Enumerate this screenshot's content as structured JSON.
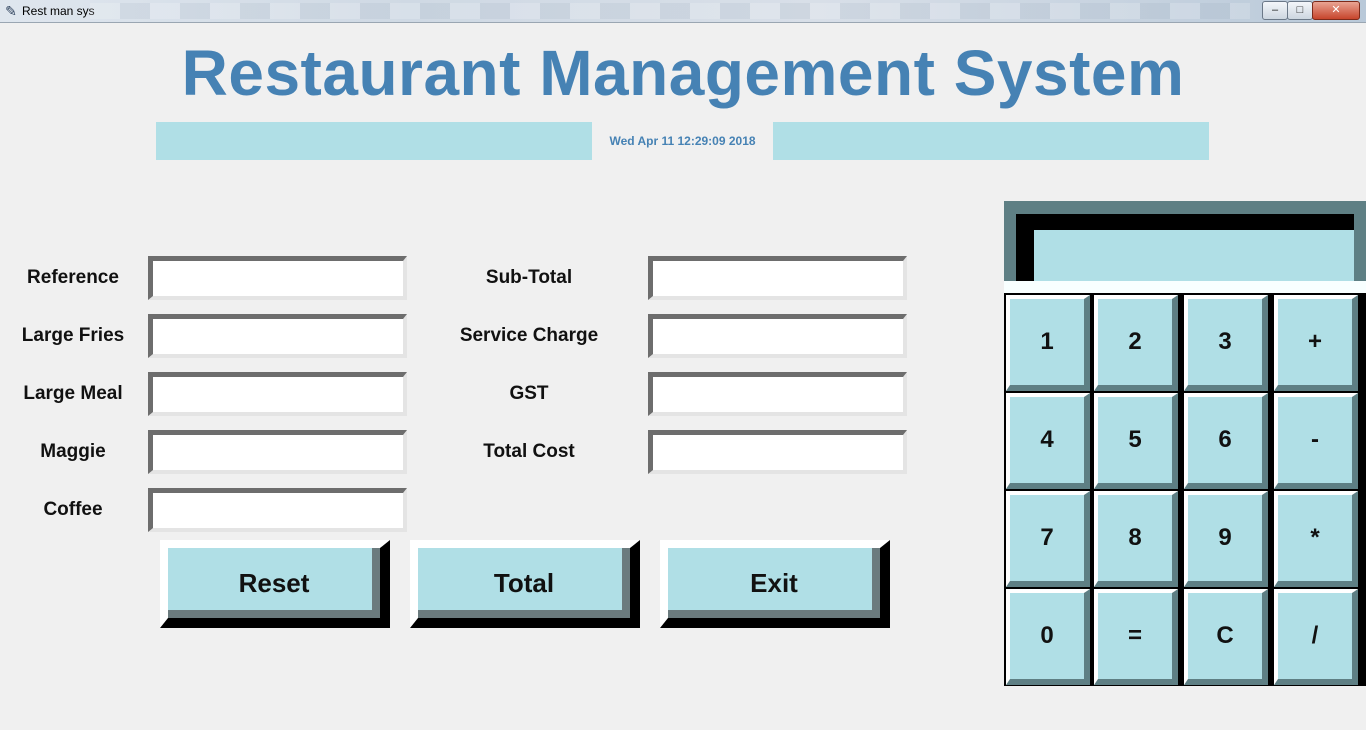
{
  "window": {
    "title": "Rest man sys",
    "icon": "feather-icon",
    "controls": {
      "minimize": "‒",
      "maximize": "□",
      "close": "✕"
    }
  },
  "header": {
    "title": "Restaurant Management System",
    "datetime": "Wed Apr 11 12:29:09 2018"
  },
  "form": {
    "left": [
      {
        "label": "Reference",
        "value": ""
      },
      {
        "label": "Large Fries",
        "value": ""
      },
      {
        "label": "Large Meal",
        "value": ""
      },
      {
        "label": "Maggie",
        "value": ""
      },
      {
        "label": "Coffee",
        "value": ""
      }
    ],
    "right": [
      {
        "label": "Sub-Total",
        "value": ""
      },
      {
        "label": "Service Charge",
        "value": ""
      },
      {
        "label": "GST",
        "value": ""
      },
      {
        "label": "Total Cost",
        "value": ""
      }
    ]
  },
  "actions": {
    "reset": "Reset",
    "total": "Total",
    "exit": "Exit"
  },
  "calculator": {
    "display": "",
    "keys": [
      [
        "1",
        "2",
        "3",
        "+"
      ],
      [
        "4",
        "5",
        "6",
        "-"
      ],
      [
        "7",
        "8",
        "9",
        "*"
      ],
      [
        "0",
        "=",
        "C",
        "/"
      ]
    ]
  },
  "colors": {
    "accent": "#4682b4",
    "panel": "#b0dfe6",
    "background": "#f0f0f0"
  }
}
